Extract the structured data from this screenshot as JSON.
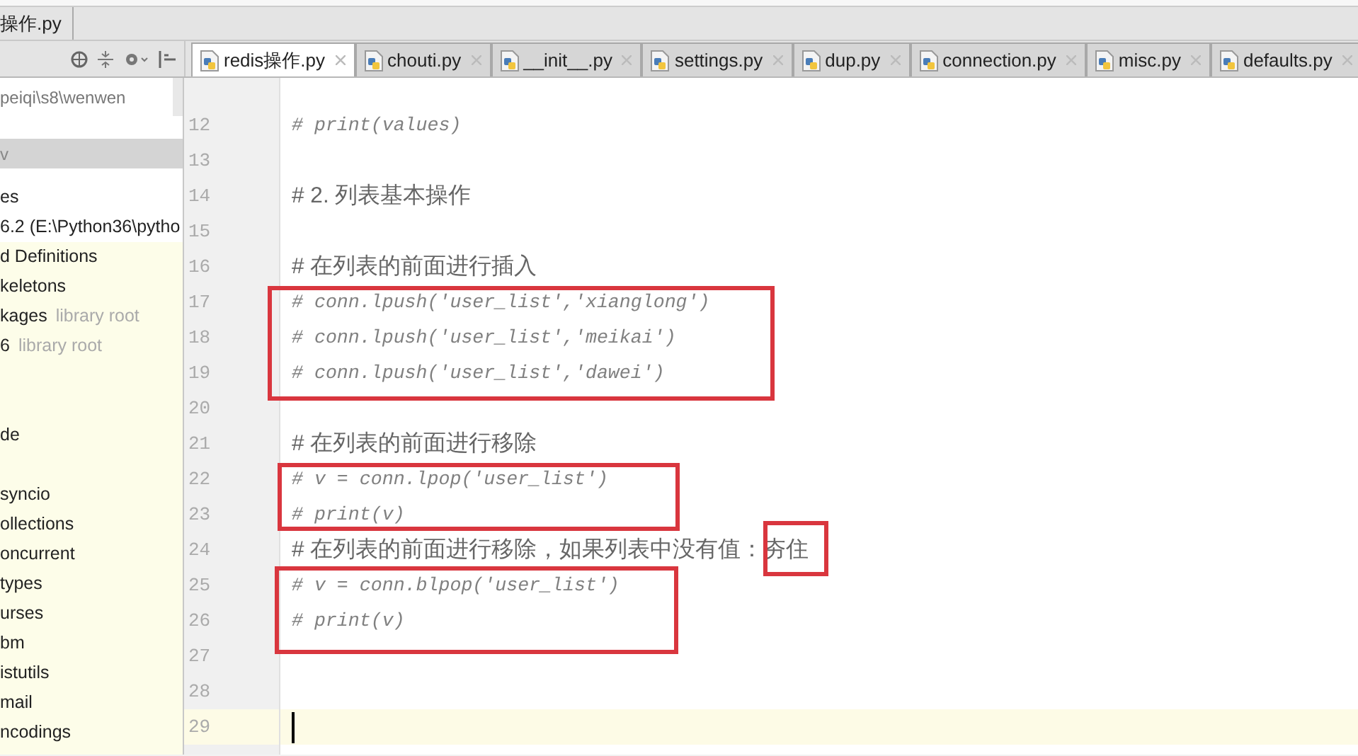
{
  "breadcrumb": "操作.py",
  "tabs": [
    {
      "label": "redis操作.py",
      "selected": true
    },
    {
      "label": "chouti.py",
      "selected": false
    },
    {
      "label": "__init__.py",
      "selected": false
    },
    {
      "label": "settings.py",
      "selected": false
    },
    {
      "label": "dup.py",
      "selected": false
    },
    {
      "label": "connection.py",
      "selected": false
    },
    {
      "label": "misc.py",
      "selected": false
    },
    {
      "label": "defaults.py",
      "selected": false
    }
  ],
  "project": {
    "path": "peiqi\\s8\\wenwen",
    "header": {
      "label": "v",
      "selected": true
    },
    "items": [
      {
        "label": "es"
      },
      {
        "label": "6.2 (E:\\Python36\\pytho"
      },
      {
        "label": "d Definitions"
      },
      {
        "label": "keletons"
      },
      {
        "label": "kages",
        "note": "library root"
      },
      {
        "label": "6",
        "note": "library root"
      },
      {
        "label": "de"
      },
      {
        "label": "syncio"
      },
      {
        "label": "ollections"
      },
      {
        "label": "oncurrent"
      },
      {
        "label": "types"
      },
      {
        "label": "urses"
      },
      {
        "label": "bm"
      },
      {
        "label": "istutils"
      },
      {
        "label": "mail"
      },
      {
        "label": "ncodings"
      }
    ]
  },
  "editor": {
    "lines": [
      {
        "number": "12",
        "kind": "code",
        "text": "# print(values)"
      },
      {
        "number": "13",
        "kind": "blank"
      },
      {
        "number": "14",
        "kind": "note",
        "text": "# 2. 列表基本操作"
      },
      {
        "number": "15",
        "kind": "blank"
      },
      {
        "number": "16",
        "kind": "note",
        "text": "# 在列表的前面进行插入"
      },
      {
        "number": "17",
        "kind": "code",
        "text": "# conn.lpush('user_list','xianglong')"
      },
      {
        "number": "18",
        "kind": "code",
        "text": "# conn.lpush('user_list','meikai')"
      },
      {
        "number": "19",
        "kind": "code",
        "text": "# conn.lpush('user_list','dawei')"
      },
      {
        "number": "20",
        "kind": "blank"
      },
      {
        "number": "21",
        "kind": "note",
        "text": "# 在列表的前面进行移除"
      },
      {
        "number": "22",
        "kind": "code",
        "text": "# v = conn.lpop('user_list')"
      },
      {
        "number": "23",
        "kind": "code",
        "text": "# print(v)"
      },
      {
        "number": "24",
        "kind": "note",
        "text": "# 在列表的前面进行移除，如果列表中没有值：夯住"
      },
      {
        "number": "25",
        "kind": "code",
        "text": "# v = conn.blpop('user_list')"
      },
      {
        "number": "26",
        "kind": "code",
        "text": "# print(v)"
      },
      {
        "number": "27",
        "kind": "blank"
      },
      {
        "number": "28",
        "kind": "blank"
      },
      {
        "number": "29",
        "kind": "blank",
        "current": true
      }
    ]
  }
}
